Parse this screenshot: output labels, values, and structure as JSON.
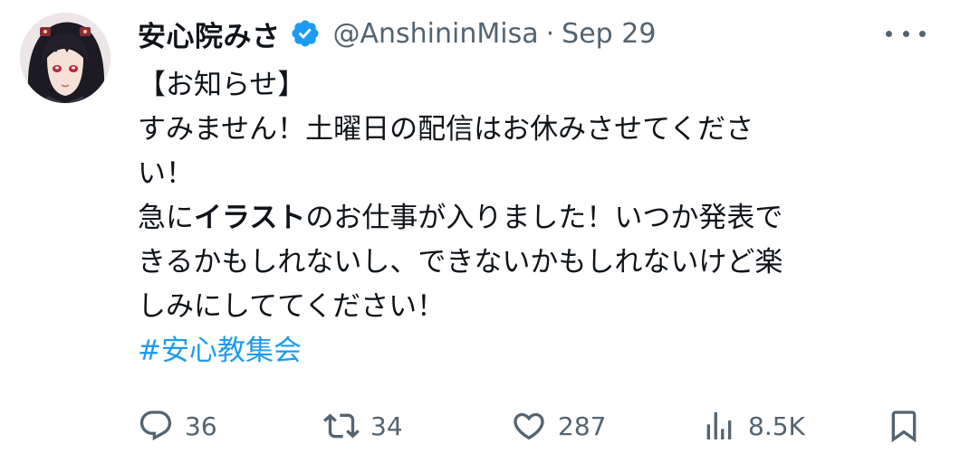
{
  "author": {
    "display_name": "安心院みさ",
    "handle": "@AnshininMisa",
    "separator": "·",
    "date": "Sep 29",
    "verified": true
  },
  "tweet": {
    "lines": [
      {
        "segments": [
          {
            "text": "【お知らせ】"
          }
        ]
      },
      {
        "segments": [
          {
            "text": "すみません！土曜日の配信はお休みさせてくださ"
          }
        ]
      },
      {
        "segments": [
          {
            "text": "い！"
          }
        ]
      },
      {
        "segments": [
          {
            "text": "急に"
          },
          {
            "text": "イラスト",
            "bold": true
          },
          {
            "text": "のお仕事が入りました！いつか発表で"
          }
        ]
      },
      {
        "segments": [
          {
            "text": "きるかもしれないし、できないかもしれないけど楽"
          }
        ]
      },
      {
        "segments": [
          {
            "text": "しみにしててください！"
          }
        ]
      }
    ],
    "hashtag": "#安心教集会"
  },
  "actions": {
    "reply": {
      "icon": "reply-icon",
      "count": "36"
    },
    "retweet": {
      "icon": "retweet-icon",
      "count": "34"
    },
    "like": {
      "icon": "heart-icon",
      "count": "287"
    },
    "views": {
      "icon": "views-icon",
      "count": "8.5K"
    },
    "bookmark": {
      "icon": "bookmark-icon"
    }
  },
  "colors": {
    "text": "#0f1419",
    "secondary": "#536471",
    "link": "#1d9bf0",
    "verified": "#1d9bf0"
  }
}
